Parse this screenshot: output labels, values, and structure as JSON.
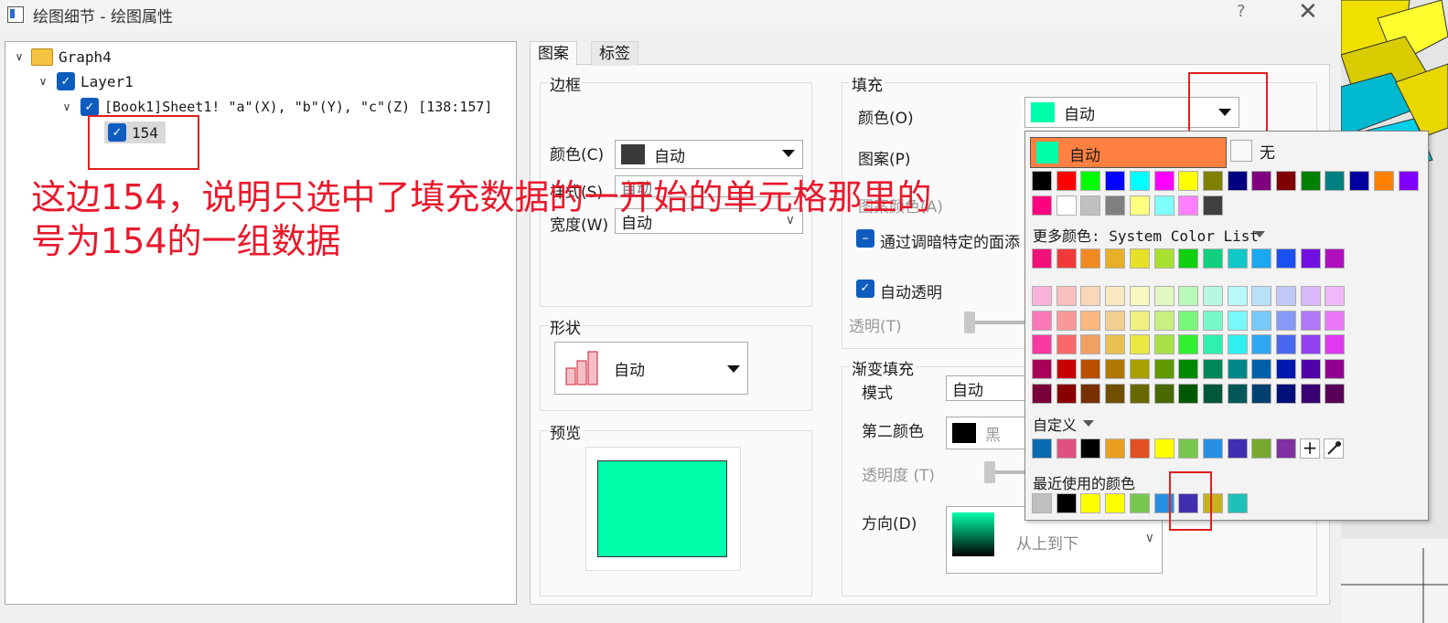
{
  "window": {
    "title": "绘图细节 - 绘图属性",
    "help": "?",
    "close": "✕"
  },
  "tree": {
    "graph": "Graph4",
    "layer": "Layer1",
    "dataset": "[Book1]Sheet1! \"a\"(X), \"b\"(Y), \"c\"(Z) [138:157]",
    "item": "154"
  },
  "annotation": {
    "line1": "这边154，说明只选中了填充数据的一开始的单元格那里的",
    "line2": "号为154的一组数据"
  },
  "tabs": {
    "pattern": "图案",
    "labels": "标签"
  },
  "border": {
    "title": "边框",
    "color_label": "颜色(C)",
    "color_value": "自动",
    "color_swatch": "#3a3a3a",
    "style_label": "样式(S)",
    "style_value": "自动",
    "width_label": "宽度(W)",
    "width_value": "自动"
  },
  "shape": {
    "title": "形状",
    "value": "自动"
  },
  "preview": {
    "title": "预览",
    "fill": "#00ffaa"
  },
  "fill": {
    "title": "填充",
    "color_label": "颜色(O)",
    "color_value": "自动",
    "color_swatch": "#00ffaa",
    "pattern_label": "图案(P)",
    "pattern_color_label": "图案颜色(A)",
    "darken_label": "通过调暗特定的面添",
    "auto_transparent_label": "自动透明",
    "transparency_label": "透明(T)"
  },
  "gradient": {
    "title": "渐变填充",
    "mode_label": "模式",
    "mode_value": "自动",
    "second_color_label": "第二颜色",
    "second_color_value": "黑",
    "transparency_label": "透明度 (T)",
    "direction_label": "方向(D)",
    "direction_value": "从上到下"
  },
  "color_popup": {
    "auto_label": "自动",
    "auto_swatch": "#00ffaa",
    "auto_bg": "#ff8040",
    "none_label": "无",
    "basic_colors": [
      "#000000",
      "#ff0000",
      "#00ff00",
      "#0000ff",
      "#00ffff",
      "#ff00ff",
      "#ffff00",
      "#808000",
      "#000080",
      "#800080",
      "#800000",
      "#008000",
      "#008080",
      "#0000a0",
      "#ff8000",
      "#8000ff",
      "#ff0080",
      "#ffffff",
      "#c0c0c0",
      "#808080",
      "#ffff80",
      "#80ffff",
      "#ff80ff",
      "#404040"
    ],
    "more_colors_label": "更多颜色: System Color List",
    "palette_main": [
      "#f0127a",
      "#f03a3a",
      "#f08a20",
      "#e8b028",
      "#e6e029",
      "#a8e030",
      "#10d010",
      "#10d080",
      "#10c8c8",
      "#1aa8f0",
      "#1a50f0",
      "#7010e0",
      "#b010c0"
    ],
    "palette_rows": [
      [
        "#f8b4d8",
        "#f8c0c0",
        "#f8d8b8",
        "#f8e8c0",
        "#f8f8c0",
        "#e0f8c0",
        "#b8f8b8",
        "#b8f8e0",
        "#b8f8f8",
        "#b8e0f8",
        "#c0c8f8",
        "#d8b8f8",
        "#f0b8f8"
      ],
      [
        "#f878b8",
        "#f89898",
        "#f8b880",
        "#f0d090",
        "#f0f080",
        "#c8f080",
        "#78f878",
        "#78f8c8",
        "#78f8f8",
        "#78c8f8",
        "#8898f8",
        "#b078f8",
        "#e878f8"
      ],
      [
        "#f838a0",
        "#f86868",
        "#f0a060",
        "#e8c050",
        "#e8e840",
        "#a8e048",
        "#30f030",
        "#30f0b0",
        "#30f0f0",
        "#30a8f0",
        "#4868f0",
        "#9040f0",
        "#e038f0"
      ],
      [
        "#a80058",
        "#c80000",
        "#b85000",
        "#b07800",
        "#a8a000",
        "#609800",
        "#008800",
        "#008858",
        "#008888",
        "#0060a8",
        "#0018b0",
        "#5000a8",
        "#900090"
      ],
      [
        "#780038",
        "#880000",
        "#783000",
        "#705000",
        "#686800",
        "#486800",
        "#005800",
        "#005838",
        "#005858",
        "#004070",
        "#001078",
        "#380070",
        "#580058"
      ]
    ],
    "custom_label": "自定义",
    "custom_colors": [
      "#0a6ab0",
      "#e05080",
      "#000000",
      "#e8a020",
      "#e05020",
      "#ffff00",
      "#78c850",
      "#2890e0",
      "#4030b0",
      "#78a830",
      "#8030a0"
    ],
    "add_label": "+",
    "recent_label": "最近使用的颜色",
    "recent_colors": [
      "#c0c0c0",
      "#000000",
      "#ffff00",
      "#ffff00",
      "#78c850",
      "#2890e0",
      "#4030b0",
      "#c8b020",
      "#20c0b8"
    ]
  }
}
